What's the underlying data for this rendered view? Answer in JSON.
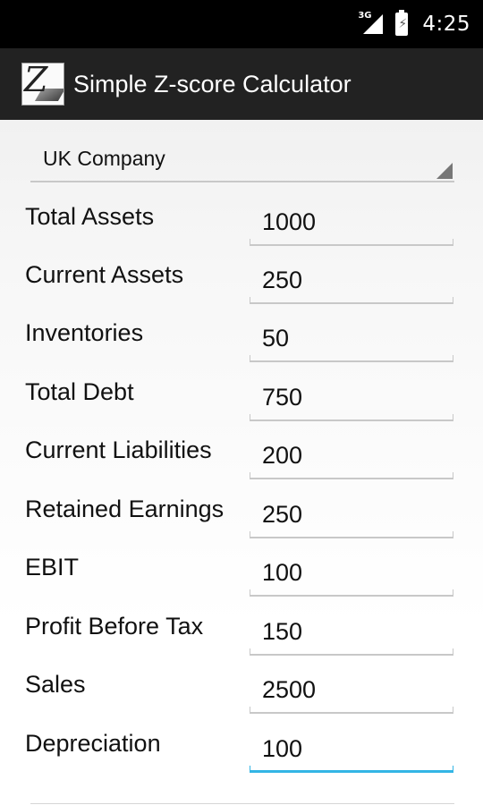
{
  "status_bar": {
    "network_type": "3G",
    "time": "4:25",
    "icons": [
      "signal-icon",
      "battery-charging-icon"
    ]
  },
  "action_bar": {
    "app_icon": "z-score-logo-icon",
    "title": "Simple Z-score Calculator"
  },
  "company_type": {
    "selected": "UK Company"
  },
  "fields": [
    {
      "label": "Total Assets",
      "value": "1000"
    },
    {
      "label": "Current Assets",
      "value": "250"
    },
    {
      "label": "Inventories",
      "value": "50"
    },
    {
      "label": "Total Debt",
      "value": "750"
    },
    {
      "label": "Current Liabilities",
      "value": "200"
    },
    {
      "label": "Retained Earnings",
      "value": "250"
    },
    {
      "label": "EBIT",
      "value": "100"
    },
    {
      "label": "Profit Before Tax",
      "value": "150"
    },
    {
      "label": "Sales",
      "value": "2500"
    },
    {
      "label": "Depreciation",
      "value": "100"
    }
  ],
  "focused_field": "Depreciation",
  "colors": {
    "status_bar": "#000000",
    "action_bar": "#222222",
    "focus_accent": "#33b5e5",
    "underline": "#c8c8c8"
  }
}
